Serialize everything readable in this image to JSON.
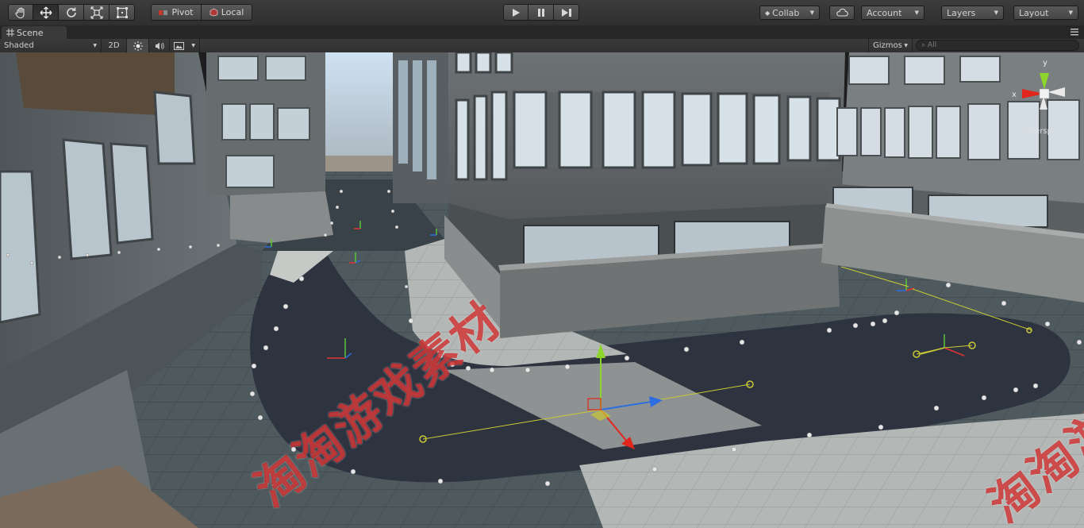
{
  "toolbar": {
    "tools": [
      "hand-tool",
      "move-tool",
      "rotate-tool",
      "scale-tool",
      "rect-tool"
    ],
    "pivot_label": "Pivot",
    "local_label": "Local",
    "playback": [
      "play",
      "pause",
      "step"
    ],
    "collab_label": "Collab",
    "account_label": "Account",
    "layers_label": "Layers",
    "layout_label": "Layout"
  },
  "scene_tab": {
    "label": "Scene"
  },
  "scene_toolbar": {
    "shading_mode": "Shaded",
    "two_d_label": "2D",
    "gizmos_label": "Gizmos",
    "search_placeholder": "All"
  },
  "viewport": {
    "projection_label": "Persp",
    "axis_x_label": "x",
    "axis_y_label": "y",
    "watermark_text": "淘淘游戏素材"
  },
  "colors": {
    "axis_x": "#e2261d",
    "axis_y": "#8dd52b",
    "axis_z": "#2d6de0",
    "waypoint_line": "#c9c935"
  }
}
